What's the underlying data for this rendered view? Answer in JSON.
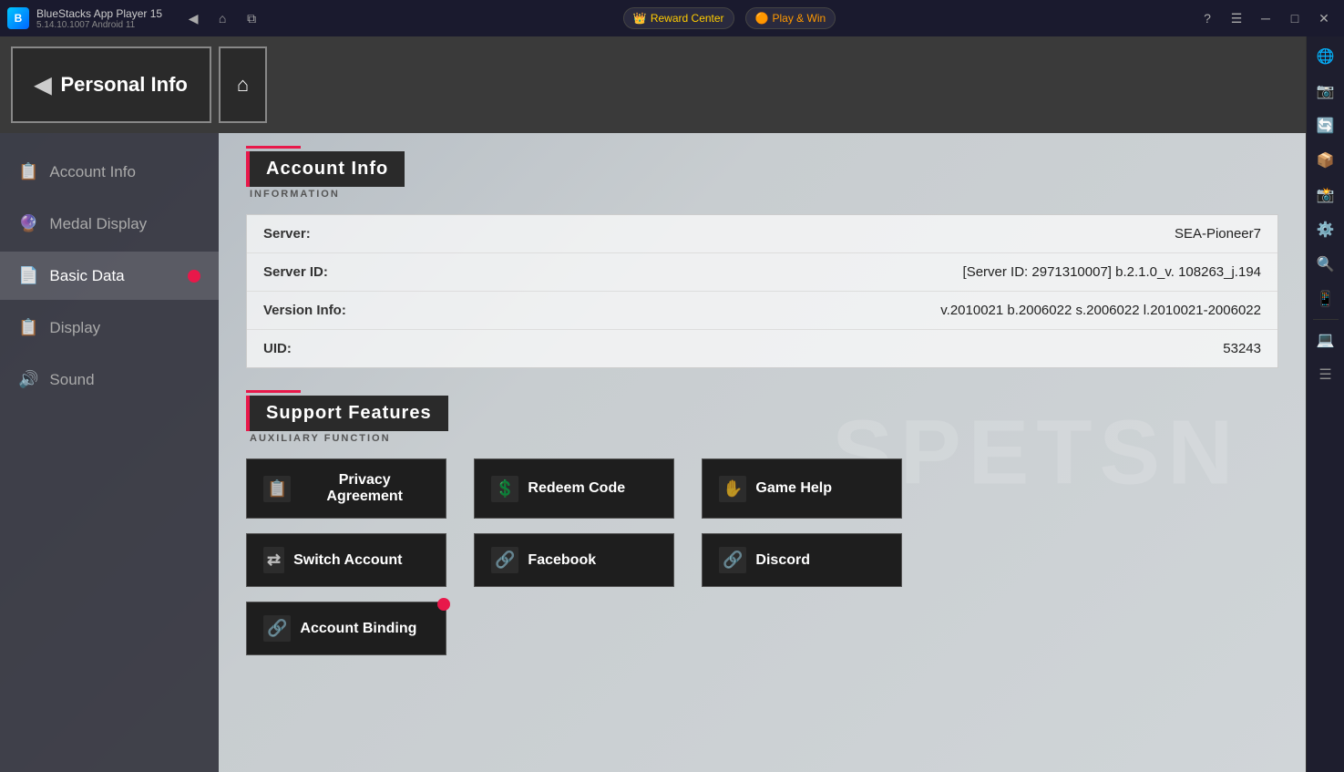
{
  "titlebar": {
    "app_name": "BlueStacks App Player 15",
    "app_version": "5.14.10.1007  Android 11",
    "reward_center": "Reward Center",
    "play_win": "Play & Win",
    "nav": {
      "back": "◀",
      "home": "⌂",
      "copy": "⧉"
    },
    "window_controls": {
      "help": "?",
      "menu": "☰",
      "minimize": "─",
      "maximize": "□",
      "close": "✕"
    }
  },
  "sidebar_items": [
    {
      "label": "Account Info",
      "icon": "📋",
      "active": false,
      "notification": false
    },
    {
      "label": "Medal Display",
      "icon": "🔮",
      "active": false,
      "notification": false
    },
    {
      "label": "Basic Data",
      "icon": "📄",
      "active": true,
      "notification": true
    },
    {
      "label": "Display",
      "icon": "📋",
      "active": false,
      "notification": false
    },
    {
      "label": "Sound",
      "icon": "🔊",
      "active": false,
      "notification": false
    }
  ],
  "header": {
    "personal_info": "Personal Info",
    "back_arrow": "◀"
  },
  "account_info_section": {
    "title": "Account Info",
    "subtitle": "INFORMATION",
    "fields": [
      {
        "label": "Server:",
        "value": "SEA-Pioneer7"
      },
      {
        "label": "Server ID:",
        "value": "[Server ID: 2971310007] b.2.1.0_v. 108263_j.194"
      },
      {
        "label": "Version Info:",
        "value": "v.2010021 b.2006022 s.2006022 l.2010021-2006022"
      },
      {
        "label": "UID:",
        "value": "53243"
      }
    ]
  },
  "support_features_section": {
    "title": "Support Features",
    "subtitle": "AUXILIARY FUNCTION",
    "buttons": [
      {
        "label": "Privacy Agreement",
        "icon": "📋",
        "row": 0,
        "col": 0,
        "notification": false
      },
      {
        "label": "Redeem Code",
        "icon": "💰",
        "row": 0,
        "col": 1,
        "notification": false
      },
      {
        "label": "Game Help",
        "icon": "✋",
        "row": 0,
        "col": 2,
        "notification": false
      },
      {
        "label": "Switch Account",
        "icon": "🔄",
        "row": 1,
        "col": 0,
        "notification": false
      },
      {
        "label": "Facebook",
        "icon": "🔗",
        "row": 1,
        "col": 1,
        "notification": false
      },
      {
        "label": "Discord",
        "icon": "🔗",
        "row": 1,
        "col": 2,
        "notification": false
      },
      {
        "label": "Account Binding",
        "icon": "🔗",
        "row": 2,
        "col": 0,
        "notification": true
      }
    ]
  },
  "bg_text": "SPETSN",
  "right_sidebar_icons": [
    "🌐",
    "📷",
    "🔄",
    "📦",
    "📸",
    "⚙️",
    "🔍",
    "📱",
    "💻",
    "☰"
  ]
}
